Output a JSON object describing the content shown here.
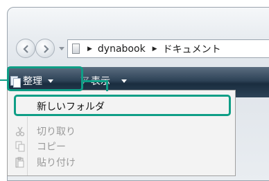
{
  "address_bar": {
    "crumbs": [
      "dynabook",
      "ドキュメント"
    ]
  },
  "toolbar": {
    "organize_label": "整理",
    "view_label_partial": "ア",
    "view_label": "表示"
  },
  "menu": {
    "items": [
      {
        "label": "新しいフォルダ",
        "enabled": true,
        "icon": "none"
      },
      {
        "label": "切り取り",
        "enabled": false,
        "icon": "scissors-icon"
      },
      {
        "label": "コピー",
        "enabled": false,
        "icon": "copy-icon"
      },
      {
        "label": "貼り付け",
        "enabled": false,
        "icon": "paste-icon"
      }
    ]
  },
  "colors": {
    "highlight": "#0e9e86",
    "toolbar_dark": "#1a2d3f"
  }
}
